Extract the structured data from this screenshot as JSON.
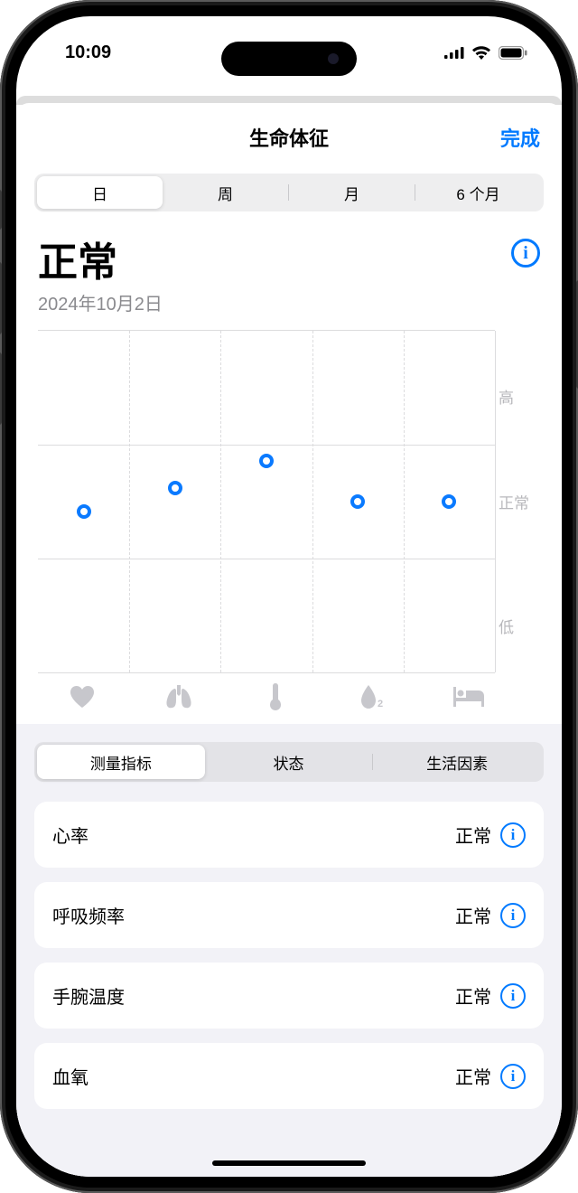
{
  "status_bar": {
    "time": "10:09"
  },
  "header": {
    "title": "生命体征",
    "done": "完成"
  },
  "time_segments": [
    "日",
    "周",
    "月",
    "6 个月"
  ],
  "status": {
    "label": "正常",
    "date": "2024年10月2日"
  },
  "chart_data": {
    "type": "scatter",
    "y_labels": {
      "high": "高",
      "normal": "正常",
      "low": "低"
    },
    "x_icons": [
      "heart-icon",
      "lungs-icon",
      "thermometer-icon",
      "oxygen-icon",
      "bed-icon"
    ],
    "points": [
      {
        "x": 10,
        "y": 53
      },
      {
        "x": 30,
        "y": 46
      },
      {
        "x": 50,
        "y": 38
      },
      {
        "x": 70,
        "y": 50
      },
      {
        "x": 90,
        "y": 50
      }
    ]
  },
  "lower_segments": [
    "测量指标",
    "状态",
    "生活因素"
  ],
  "metrics": [
    {
      "name": "心率",
      "status": "正常"
    },
    {
      "name": "呼吸频率",
      "status": "正常"
    },
    {
      "name": "手腕温度",
      "status": "正常"
    },
    {
      "name": "血氧",
      "status": "正常"
    }
  ]
}
